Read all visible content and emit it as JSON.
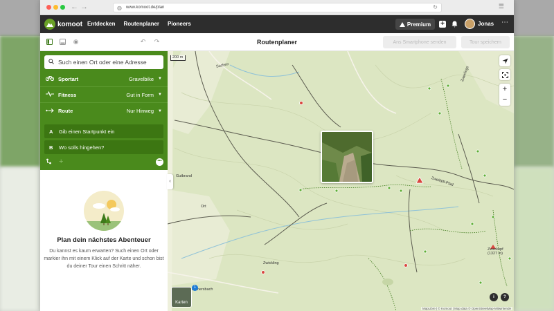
{
  "browser": {
    "url": "www.komoot.de/plan"
  },
  "header": {
    "brand": "komoot",
    "nav": [
      "Entdecken",
      "Routenplaner",
      "Pioneers"
    ],
    "premium_label": "Premium",
    "username": "Jonas"
  },
  "toolbar": {
    "title": "Routenplaner",
    "send_label": "Ans Smartphone senden",
    "save_label": "Tour speichern"
  },
  "sidebar": {
    "search_placeholder": "Such einen Ort oder eine Adresse",
    "options": [
      {
        "label": "Sportart",
        "value": "Gravelbike",
        "icon": "bike-icon"
      },
      {
        "label": "Fitness",
        "value": "Gut in Form",
        "icon": "pulse-icon"
      },
      {
        "label": "Route",
        "value": "Nur Hinweg",
        "icon": "route-arrow-icon"
      }
    ],
    "waypoints": [
      {
        "letter": "A",
        "text": "Gib einen Startpunkt ein"
      },
      {
        "letter": "B",
        "text": "Wo solls hingehen?"
      }
    ]
  },
  "empty_state": {
    "title": "Plan dein nächstes Abenteuer",
    "text": "Du kannst es kaum erwarten? Such einen Ort oder markier ihn mit einem Klick auf der Karte und schon bist du deiner Tour einen Schritt näher."
  },
  "map": {
    "scale": "200 m",
    "layers_label": "Karten",
    "layers_count": "1",
    "attribution": "MapLibre | © Komoot | Map data © OpenStreetMap-Mitwirkende",
    "places": [
      "Suchen",
      "Gutbrand",
      "Zwickling",
      "Ort",
      "Zwerlings",
      "Kammersbach",
      "Zweifaltl-Pfad",
      "Zwerkopf (1327 m)"
    ],
    "colors": {
      "green": "#4a8a1c",
      "map_base": "#dce6c2"
    }
  }
}
